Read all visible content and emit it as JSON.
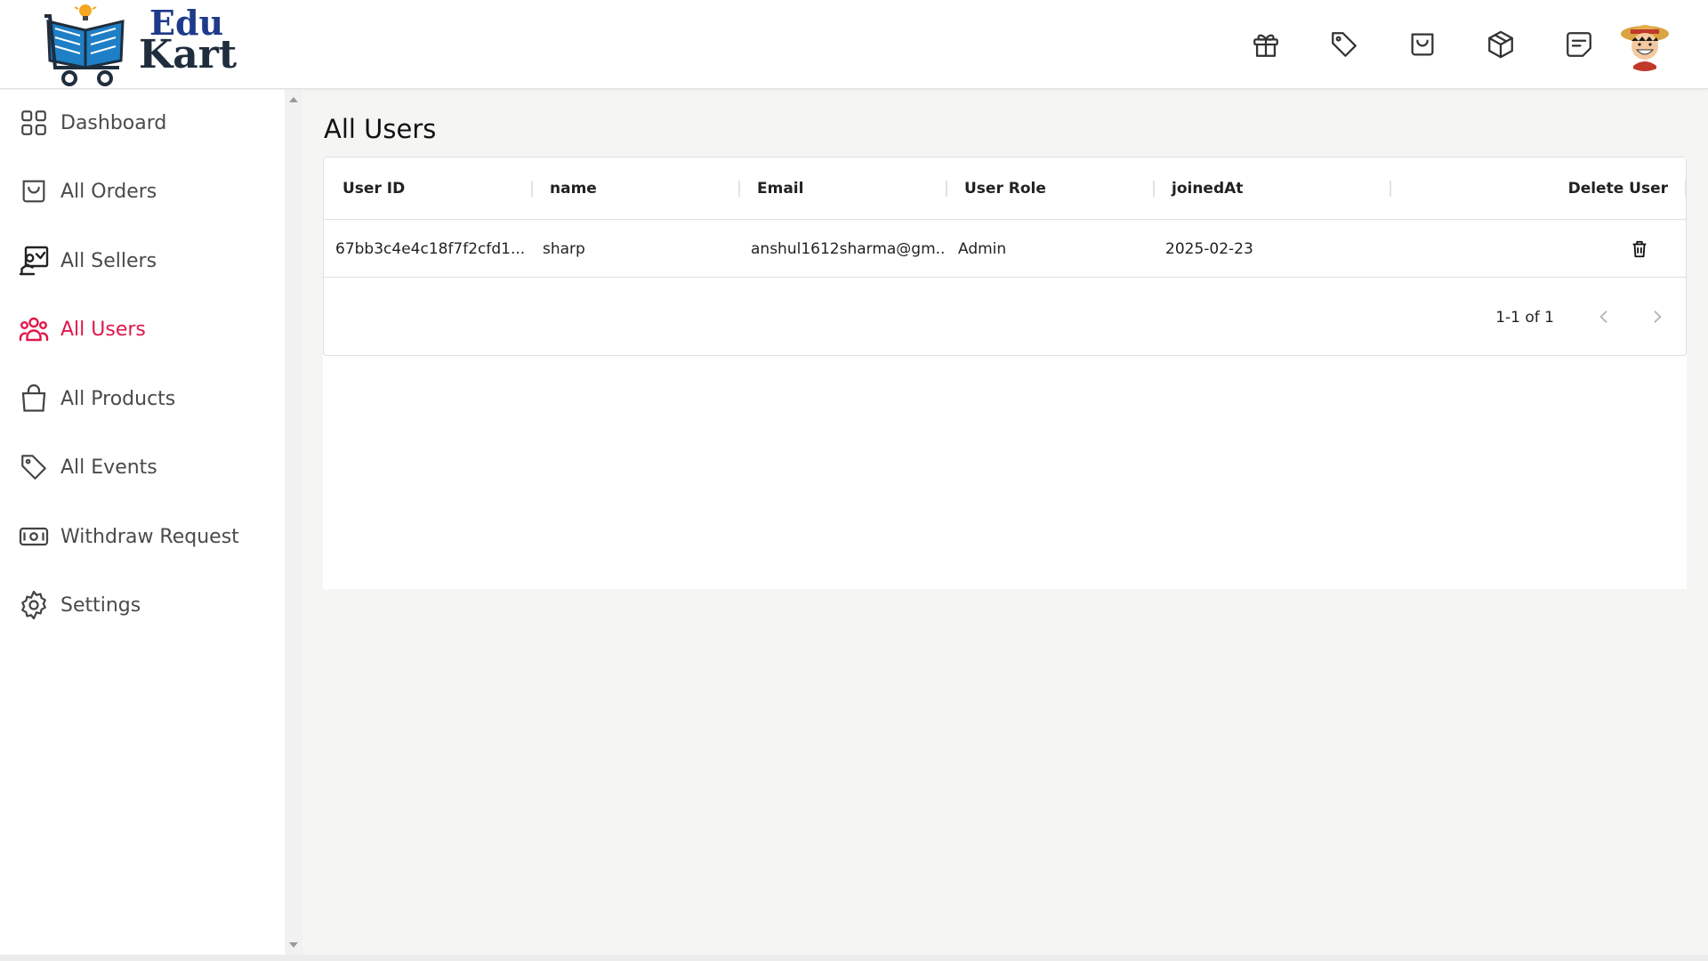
{
  "brand": {
    "line1": "Edu",
    "line2": "Kart",
    "colors": {
      "primary": "#1e3a8a",
      "dark": "#1f2d3d",
      "accent": "#e0174a"
    }
  },
  "header": {
    "icons": [
      "gift-icon",
      "tag-icon",
      "shopping-bag-icon",
      "package-icon",
      "message-icon"
    ],
    "avatar": "user-avatar"
  },
  "sidebar": {
    "items": [
      {
        "label": "Dashboard",
        "icon": "dashboard-icon",
        "active": false
      },
      {
        "label": "All Orders",
        "icon": "shopping-bag-icon",
        "active": false
      },
      {
        "label": "All Sellers",
        "icon": "seller-icon",
        "active": false
      },
      {
        "label": "All Users",
        "icon": "users-icon",
        "active": true
      },
      {
        "label": "All Products",
        "icon": "bag-icon",
        "active": false
      },
      {
        "label": "All Events",
        "icon": "tag-icon",
        "active": false
      },
      {
        "label": "Withdraw Request",
        "icon": "money-icon",
        "active": false
      },
      {
        "label": "Settings",
        "icon": "settings-icon",
        "active": false
      }
    ]
  },
  "main": {
    "title": "All Users",
    "table": {
      "columns": [
        "User ID",
        "name",
        "Email",
        "User Role",
        "joinedAt",
        "Delete User"
      ],
      "rows": [
        {
          "user_id": "67bb3c4e4c18f7f2cfd1...",
          "name": "sharp",
          "email": "anshul1612sharma@gm...",
          "role": "Admin",
          "joined": "2025-02-23"
        }
      ],
      "pagination": "1-1 of 1"
    }
  }
}
